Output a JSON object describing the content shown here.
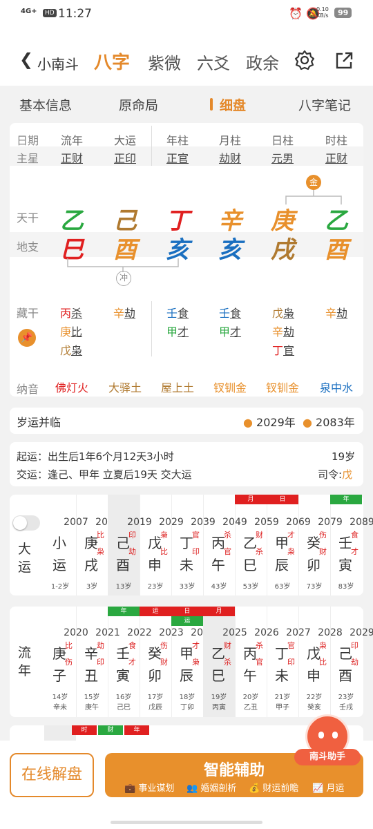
{
  "status": {
    "network": "4G+",
    "hd": "HD",
    "time": "11:27",
    "speed_value": "0.10",
    "speed_unit": "KB/s",
    "battery": "99"
  },
  "header": {
    "back_label": "小南斗",
    "tabs": [
      "八字",
      "紫微",
      "六爻",
      "政余"
    ]
  },
  "subtabs": [
    "基本信息",
    "原命局",
    "细盘",
    "八字笔记"
  ],
  "pillars": {
    "row_labels": {
      "date": "日期",
      "main_star": "主星",
      "tiangan": "天干",
      "dizhi": "地支",
      "canggan": "藏干",
      "nayin": "纳音"
    },
    "columns": [
      {
        "name": "流年",
        "star": "正财",
        "gan": "乙",
        "gan_color": "#2aa840",
        "zhi": "巳",
        "zhi_color": "#e02020",
        "nayin": "佛灯火",
        "nayin_color": "#e02020"
      },
      {
        "name": "大运",
        "star": "正印",
        "gan": "己",
        "gan_color": "#b07a30",
        "zhi": "酉",
        "zhi_color": "#e8902c",
        "nayin": "大驿土",
        "nayin_color": "#b07a30"
      },
      {
        "name": "年柱",
        "star": "正官",
        "gan": "丁",
        "gan_color": "#e02020",
        "zhi": "亥",
        "zhi_color": "#1a6fc0",
        "nayin": "屋上土",
        "nayin_color": "#b07a30"
      },
      {
        "name": "月柱",
        "star": "劫财",
        "gan": "辛",
        "gan_color": "#e8902c",
        "zhi": "亥",
        "zhi_color": "#1a6fc0",
        "nayin": "钗钏金",
        "nayin_color": "#e8902c"
      },
      {
        "name": "日柱",
        "star": "元男",
        "gan": "庚",
        "gan_color": "#e8902c",
        "zhi": "戌",
        "zhi_color": "#b07a30",
        "nayin": "钗钏金",
        "nayin_color": "#e8902c"
      },
      {
        "name": "时柱",
        "star": "正财",
        "gan": "乙",
        "gan_color": "#2aa840",
        "zhi": "酉",
        "zhi_color": "#e8902c",
        "nayin": "泉中水",
        "nayin_color": "#1a6fc0"
      }
    ],
    "gan_relation": "金",
    "zhi_relation": "冲",
    "hidden": [
      [
        {
          "s": "丙",
          "g": "杀",
          "c": "#e02020"
        },
        {
          "s": "庚",
          "g": "比",
          "c": "#e8902c"
        },
        {
          "s": "戊",
          "g": "枭",
          "c": "#b07a30"
        }
      ],
      [
        {
          "s": "辛",
          "g": "劫",
          "c": "#e8902c"
        }
      ],
      [
        {
          "s": "壬",
          "g": "食",
          "c": "#1a6fc0"
        },
        {
          "s": "甲",
          "g": "才",
          "c": "#2aa840"
        }
      ],
      [
        {
          "s": "壬",
          "g": "食",
          "c": "#1a6fc0"
        },
        {
          "s": "甲",
          "g": "才",
          "c": "#2aa840"
        }
      ],
      [
        {
          "s": "戊",
          "g": "枭",
          "c": "#b07a30"
        },
        {
          "s": "辛",
          "g": "劫",
          "c": "#e8902c"
        },
        {
          "s": "丁",
          "g": "官",
          "c": "#e02020"
        }
      ],
      [
        {
          "s": "辛",
          "g": "劫",
          "c": "#e8902c"
        }
      ]
    ]
  },
  "suiyun": {
    "label": "岁运并临",
    "years": [
      "2029年",
      "2083年"
    ]
  },
  "qiyun": {
    "start": "起运：出生后1年6个月12天3小时",
    "start_age": "19岁",
    "jiao": "交运：逢己、甲年 立夏后19天 交大运",
    "siling_label": "司令:",
    "siling": "戊"
  },
  "dayun": {
    "label": "大运",
    "cols": [
      {
        "year": "2007",
        "gan": "小",
        "zhi": "运",
        "age": "1-2岁",
        "sg": "",
        "sz": "",
        "tag": ""
      },
      {
        "year": "2009",
        "gan": "庚",
        "zhi": "戌",
        "age": "3岁",
        "sg": "比",
        "sz": "枭",
        "tag": ""
      },
      {
        "year": "2019",
        "gan": "己",
        "zhi": "酉",
        "age": "13岁",
        "sg": "印",
        "sz": "劫",
        "tag": ""
      },
      {
        "year": "2029",
        "gan": "戊",
        "zhi": "申",
        "age": "23岁",
        "sg": "枭",
        "sz": "比",
        "tag": ""
      },
      {
        "year": "2039",
        "gan": "丁",
        "zhi": "未",
        "age": "33岁",
        "sg": "官",
        "sz": "印",
        "tag": ""
      },
      {
        "year": "2049",
        "gan": "丙",
        "zhi": "午",
        "age": "43岁",
        "sg": "杀",
        "sz": "官",
        "tag": ""
      },
      {
        "year": "2059",
        "gan": "乙",
        "zhi": "巳",
        "age": "53岁",
        "sg": "财",
        "sz": "杀",
        "tag": "月"
      },
      {
        "year": "2069",
        "gan": "甲",
        "zhi": "辰",
        "age": "63岁",
        "sg": "才",
        "sz": "枭",
        "tag": "日"
      },
      {
        "year": "2079",
        "gan": "癸",
        "zhi": "卯",
        "age": "73岁",
        "sg": "伤",
        "sz": "财",
        "tag": ""
      },
      {
        "year": "2089",
        "gan": "壬",
        "zhi": "寅",
        "age": "83岁",
        "sg": "食",
        "sz": "才",
        "tag": "年"
      }
    ]
  },
  "liunian": {
    "label": "流年",
    "cols": [
      {
        "year": "2020",
        "gan": "庚",
        "zhi": "子",
        "age": "14岁",
        "gz": "辛未",
        "sg": "比",
        "sz": "伤",
        "tag": ""
      },
      {
        "year": "2021",
        "gan": "辛",
        "zhi": "丑",
        "age": "15岁",
        "gz": "庚午",
        "sg": "劫",
        "sz": "印",
        "tag": ""
      },
      {
        "year": "2022",
        "gan": "壬",
        "zhi": "寅",
        "age": "16岁",
        "gz": "己巳",
        "sg": "食",
        "sz": "才",
        "tag": "年"
      },
      {
        "year": "2023",
        "gan": "癸",
        "zhi": "卯",
        "age": "17岁",
        "gz": "戊辰",
        "sg": "伤",
        "sz": "财",
        "tag": "运"
      },
      {
        "year": "2024",
        "gan": "甲",
        "zhi": "辰",
        "age": "18岁",
        "gz": "丁卯",
        "sg": "才",
        "sz": "枭",
        "tag": "日",
        "tag2": "运"
      },
      {
        "year": "2025",
        "gan": "乙",
        "zhi": "巳",
        "age": "19岁",
        "gz": "丙寅",
        "sg": "财",
        "sz": "杀",
        "tag": "月"
      },
      {
        "year": "2026",
        "gan": "丙",
        "zhi": "午",
        "age": "20岁",
        "gz": "乙丑",
        "sg": "杀",
        "sz": "官",
        "tag": ""
      },
      {
        "year": "2027",
        "gan": "丁",
        "zhi": "未",
        "age": "21岁",
        "gz": "甲子",
        "sg": "官",
        "sz": "印",
        "tag": ""
      },
      {
        "year": "2028",
        "gan": "戊",
        "zhi": "申",
        "age": "22岁",
        "gz": "癸亥",
        "sg": "枭",
        "sz": "比",
        "tag": ""
      },
      {
        "year": "2029",
        "gan": "己",
        "zhi": "酉",
        "age": "23岁",
        "gz": "壬戌",
        "sg": "印",
        "sz": "劫",
        "tag": ""
      }
    ]
  },
  "next_tags": [
    "时",
    "财",
    "年"
  ],
  "bottom": {
    "online": "在线解盘",
    "assist_title": "智能辅助",
    "assist_items": [
      "事业谋划",
      "婚姻剖析",
      "财运前瞻",
      "月运"
    ],
    "helper": "南斗助手"
  }
}
